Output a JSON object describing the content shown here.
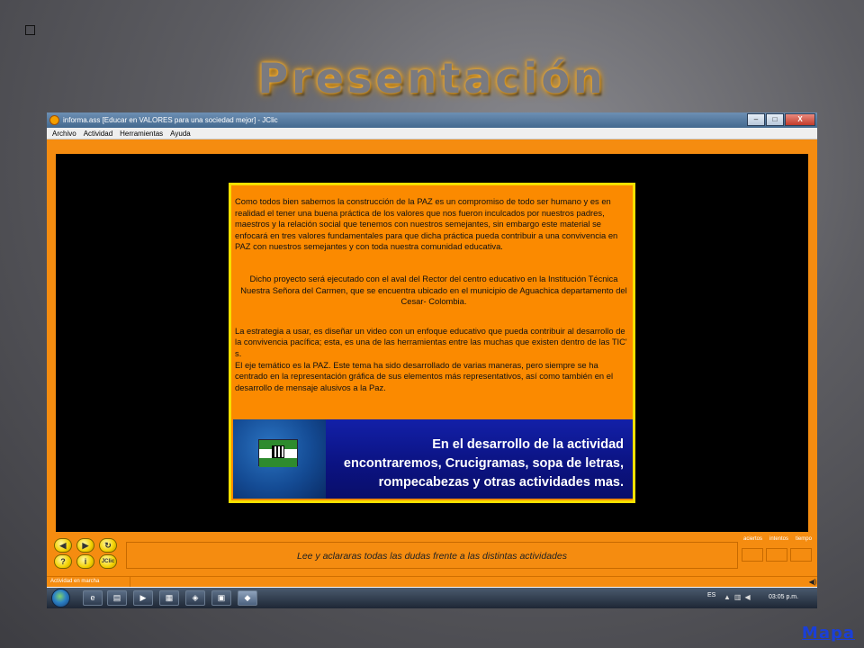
{
  "slide": {
    "title": "Presentación",
    "map_link": "Mapa"
  },
  "window": {
    "title": "informa.ass [Educar en VALORES para una sociedad mejor] - JClic",
    "buttons": [
      "–",
      "□",
      "X"
    ],
    "menu": [
      "Archivo",
      "Actividad",
      "Herramientas",
      "Ayuda"
    ]
  },
  "card": {
    "p1": "Como todos bien sabemos la construcción de la PAZ es un compromiso de todo ser humano y es en realidad el tener una buena práctica de los valores que nos fueron inculcados por nuestros padres, maestros y la relación social que tenemos con nuestros semejantes, sin embargo este material se enfocará en tres valores fundamentales para que dicha práctica pueda contribuir a una convivencia en PAZ con nuestros semejantes y con toda nuestra comunidad educativa.",
    "p2": "Dicho proyecto será ejecutado con el aval del Rector del centro educativo en la Institución Técnica Nuestra Señora del Carmen, que se encuentra ubicado en el municipio de Aguachica departamento del Cesar- Colombia.",
    "p3": "La estrategia a usar, es diseñar un video con un enfoque educativo que pueda contribuir al desarrollo de la convivencia pacífica; esta, es una de las herramientas entre las muchas que existen dentro de las TIC' s.",
    "p4": "El eje temático es la PAZ.  Este tema ha sido desarrollado de varias maneras, pero siempre se ha centrado en la representación gráfica de sus elementos más representativos, así como también en el desarrollo de mensaje alusivos a la Paz.",
    "banner_line1": "En el desarrollo de la actividad",
    "banner_line2": "encontraremos, Crucigramas, sopa de letras,",
    "banner_line3": "rompecabezas y otras actividades mas."
  },
  "controls": {
    "message": "Lee y aclararas todas las dudas frente a las distintas actividades",
    "counter_labels": [
      "aciertos",
      "intentos",
      "tiempo"
    ],
    "btn_help": "?",
    "btn_info": "i",
    "btn_jclic": "JClic"
  },
  "status": {
    "text": "Actividad en marcha"
  },
  "taskbar": {
    "lang": "ES",
    "clock": "03:05 p.m."
  },
  "colors": {
    "orange": "#f58c10",
    "card_border": "#f7e000",
    "banner_blue": "#0b1383",
    "link": "#1a3fd8"
  }
}
